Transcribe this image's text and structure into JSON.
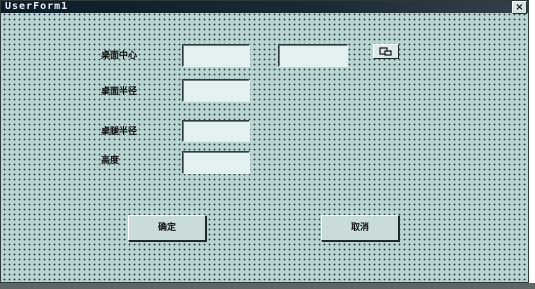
{
  "window": {
    "title": "UserForm1"
  },
  "labels": {
    "desk_center": "桌面中心",
    "desk_radius": "桌面半径",
    "leg_radius": "桌腿半径",
    "height": "高度"
  },
  "buttons": {
    "ok": "确定",
    "cancel": "取消",
    "close": "×"
  },
  "colors": {
    "form_background": "#b9d5d3",
    "textbox": "#e3f1f0",
    "titlebar": "#0b1d2a"
  },
  "icons": {
    "pick_point": "pick-point-icon"
  }
}
